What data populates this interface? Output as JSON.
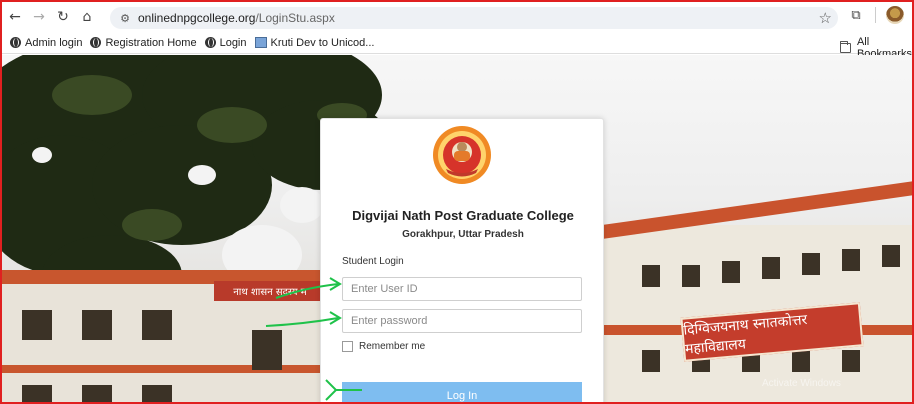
{
  "browser": {
    "url_host": "onlinednpgcollege.org",
    "url_path": "/LoginStu.aspx",
    "nav": {
      "back_icon": "back-arrow-icon",
      "forward_icon": "forward-arrow-icon",
      "reload_icon": "reload-icon",
      "home_icon": "home-icon"
    }
  },
  "bookmarks": {
    "items": [
      {
        "label": "Admin login",
        "icon": "globe-icon"
      },
      {
        "label": "Registration Home",
        "icon": "globe-icon"
      },
      {
        "label": "Login",
        "icon": "globe-icon"
      },
      {
        "label": "Kruti Dev to Unicod...",
        "icon": "image-icon"
      }
    ],
    "all_bookmarks_label": "All Bookmarks"
  },
  "scene": {
    "left_sign_text": "नाथ शासन सदस्य म",
    "right_sign_text": "दिग्विजयनाथ स्नातकोत्तर महाविद्यालय"
  },
  "login": {
    "college_name": "Digvijai Nath Post Graduate College",
    "location": "Gorakhpur, Uttar Pradesh",
    "section_label": "Student Login",
    "userid_placeholder": "Enter User ID",
    "password_placeholder": "Enter password",
    "remember_label": "Remember me",
    "login_button": "Log In"
  },
  "colors": {
    "accent": "#7ebdf0",
    "annotation_arrow": "#1fc24a",
    "frame_border": "#e02020"
  },
  "overlay": {
    "watermark": "Activate Windows"
  }
}
